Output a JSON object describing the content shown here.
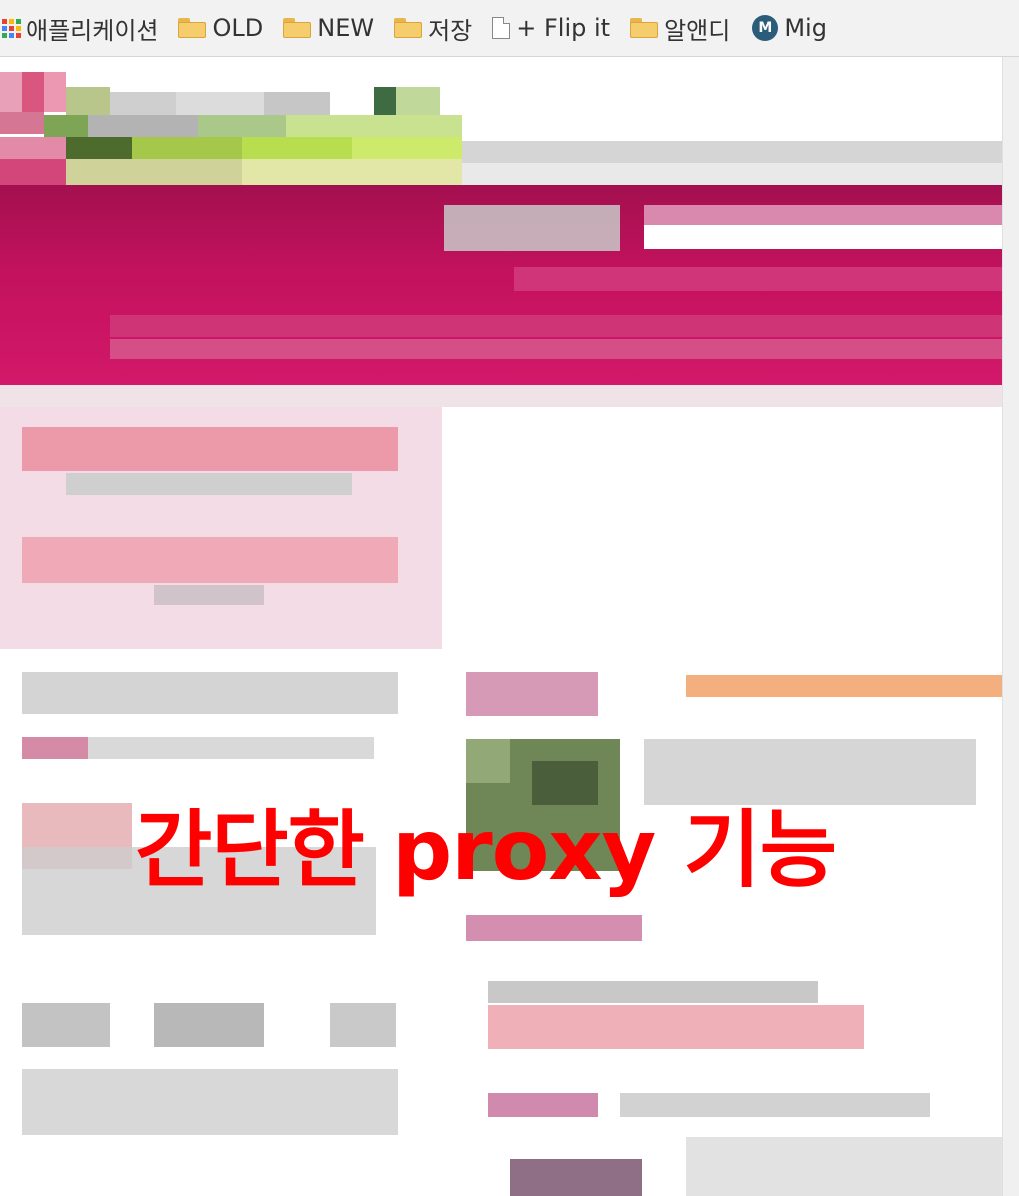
{
  "bookmarks": [
    {
      "label": "애플리케이션",
      "icon": "apps-grid-icon"
    },
    {
      "label": "OLD",
      "icon": "folder-icon"
    },
    {
      "label": "NEW",
      "icon": "folder-icon"
    },
    {
      "label": "저장",
      "icon": "folder-icon"
    },
    {
      "label": "+ Flip it",
      "icon": "page-icon"
    },
    {
      "label": "알앤디",
      "icon": "folder-icon"
    },
    {
      "label": "Mig",
      "icon": "m-logo-icon"
    }
  ],
  "overlay_caption": "간단한 proxy 기능",
  "colors": {
    "banner": "#c4125e",
    "caption": "#ff0000",
    "folder": "#f5cd6c"
  }
}
